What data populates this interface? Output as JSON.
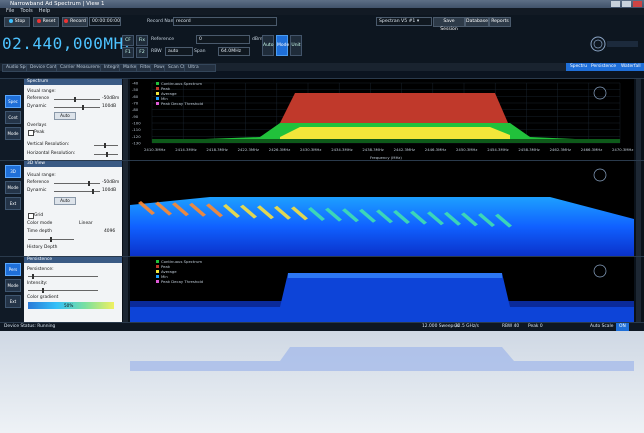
{
  "window": {
    "title": "Narrowband Ad Spectrum | View 1"
  },
  "menu": {
    "items": [
      "File",
      "Tools",
      "Help"
    ]
  },
  "toolbar": {
    "stop_label": "Stop",
    "reset_label": "Reset",
    "record_label": "Record",
    "record_value": "00:00:00:00",
    "record_name_label": "Record Name:",
    "record_name_value": "record",
    "device_select": "Spectran V5 #1",
    "save_session": "Save Session",
    "database": "Database",
    "reports": "Reports",
    "frequency_display": "02.440,000MHz",
    "span_label": "Span",
    "span_value": "64.0MHz",
    "reference_label": "Reference",
    "reference_value": "0",
    "rbw_label": "RBW",
    "rbw_value": "auto",
    "mode_buttons": [
      "CF",
      "Fix",
      "F1",
      "F2"
    ],
    "side_buttons": [
      "Auto",
      "Mode",
      "Unit"
    ],
    "unit_value": "dBm"
  },
  "tabs": {
    "left": [
      "Audio Spec",
      "Device Config",
      "Carrier Measurement",
      "Integrity",
      "Marker",
      "Filter",
      "Power",
      "Scan Ctrl",
      "Ultra"
    ],
    "right": [
      "Spectrum",
      "Persistence",
      "Waterfall"
    ]
  },
  "panel1": {
    "head": "Spectrum",
    "side": [
      "Spec",
      "Cont",
      "Mode"
    ],
    "controls": {
      "visual_range": "Visual range:",
      "reference": "Reference",
      "dynamic": "Dynamic",
      "val_ref": "-50dBm",
      "val_dyn": "100dB",
      "auto_btn": "Auto",
      "overlays": "Overlays",
      "peak_label": "Peak",
      "vert_resolution": "Vertical Resolution:",
      "horizontal_resolution": "Horizontal Resolution:"
    },
    "legend": [
      "Continuous Spectrum",
      "Peak",
      "Average",
      "Min",
      "Peak Decay Threshold"
    ],
    "x_ticks": [
      "2410.3MHz",
      "2414.3MHz",
      "2418.3MHz",
      "2422.3MHz",
      "2426.3MHz",
      "2430.3MHz",
      "2434.3MHz",
      "2438.3MHz",
      "2442.3MHz",
      "2446.3MHz",
      "2450.3MHz",
      "2454.3MHz",
      "2458.3MHz",
      "2462.3MHz",
      "2466.3MHz",
      "2470.3MHz"
    ],
    "y_ticks": [
      "-40",
      "-50",
      "-60",
      "-70",
      "-80",
      "-90",
      "-100",
      "-110",
      "-120",
      "-130"
    ],
    "x_label": "Frequency (MHz)",
    "y_label": "dBm"
  },
  "panel2": {
    "head": "3D View",
    "side": [
      "3D",
      "Mode",
      "Ext"
    ],
    "controls": {
      "visual_range": "Visual range:",
      "reference": "Reference",
      "dynamic": "Dynamic",
      "val_ref": "-50dBm",
      "val_dyn": "100dB",
      "auto_btn": "Auto",
      "grid_label": "Grid",
      "color_mode": "Color mode",
      "color_mode_value": "Linear",
      "time_depth": "Time depth",
      "time_depth_value": "4096",
      "history_depth": "History Depth"
    }
  },
  "panel3": {
    "head": "Persistence",
    "side": [
      "Pers",
      "Mode",
      "Ext"
    ],
    "controls": {
      "persistence": "Persistence:",
      "intensity": "Intensity:",
      "color_gradient": "Color gradient",
      "gradient_pct": "50%"
    },
    "legend": [
      "Continuous Spectrum",
      "Peak",
      "Average",
      "Min",
      "Peak Decay Threshold"
    ]
  },
  "status": {
    "left": "Device Status: Running",
    "mid1": "12.000 Sweeps/s",
    "mid2": "32.5 GHz/s",
    "mid3": "RBW 40",
    "mid4": "Peak 0",
    "right1": "Auto Scale",
    "right2": "ON"
  },
  "colors": {
    "accent": "#1f6fd8",
    "freq": "#4dc3ff",
    "peak": "#c0392b",
    "avg": "#f2e63a",
    "min": "#21c13b",
    "blue": "#1040ff"
  }
}
